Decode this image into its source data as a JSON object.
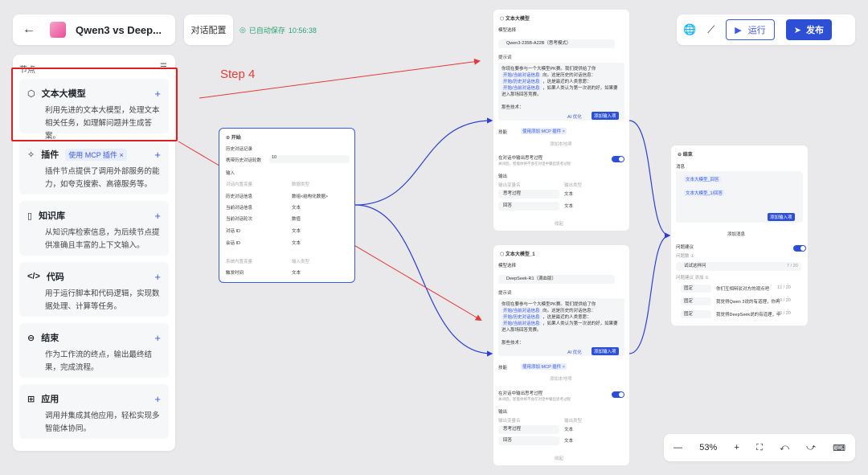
{
  "topbar": {
    "title": "Qwen3 vs Deep...",
    "config_tab": "对话配置",
    "autosave": "已自动保存",
    "autosave_time": "10:56:38",
    "run": "运行",
    "publish": "发布"
  },
  "panel": {
    "heading": "节点",
    "items": [
      {
        "name": "文本大模型",
        "desc": "利用先进的文本大模型，处理文本相关任务，如理解问题并生成答案。"
      },
      {
        "name": "插件",
        "tag": "使用 MCP 插件 ×",
        "desc": "插件节点提供了调用外部服务的能力，如夸克搜索、高德服务等。"
      },
      {
        "name": "知识库",
        "desc": "从知识库检索信息，为后续节点提供准确且丰富的上下文输入。"
      },
      {
        "name": "代码",
        "desc": "用于运行脚本和代码逻辑，实现数据处理、计算等任务。"
      },
      {
        "name": "结束",
        "desc": "作为工作流的终点，输出最终结果，完成流程。"
      },
      {
        "name": "应用",
        "desc": "调用并集成其他应用，轻松实现多智能体协同。"
      }
    ]
  },
  "annotation": "Step 4",
  "start": {
    "title": "开始",
    "history": "历史对话记录",
    "history_rounds_label": "携带历史对话轮数",
    "history_rounds": "10",
    "input": "输入",
    "col1": "对话内置变量",
    "col2": "数据类型",
    "rows": [
      [
        "历史对话信息",
        "数组<结构化数据>"
      ],
      [
        "当前对话信息",
        "文本"
      ],
      [
        "当前对话轮次",
        "数值"
      ],
      [
        "对话 ID",
        "文本"
      ],
      [
        "会话 ID",
        "文本"
      ]
    ],
    "col3": "系统内置变量",
    "col4": "输入类型",
    "trigger": "触发时间",
    "trigger_type": "文本"
  },
  "llm1": {
    "title": "文本大模型",
    "model_label": "模型选择",
    "model": "Qwen3-235B-A22B（思考模式）",
    "prompt_label": "提示词",
    "prompt": "你现在要参与一个大模型PK赛。我们提供给了你",
    "prompt_chips": [
      "开始/当前对话信息",
      "开始/历史对话信息",
      "开始/当前对话信息"
    ],
    "prompt_lines": [
      "向。这是历史的对话信息：",
      "，这是最近的人类意愿：",
      "，如果人类认为第一次说的好，如果要",
      "进入那场回答竞赛。"
    ],
    "prompt_end": "那些技术：",
    "ai_opt": "AI 优化",
    "add_input": "添加输入项",
    "skill": "技能",
    "skill_tag": "使用添加 MCP 插件 ×",
    "add_skill": "添加本地项",
    "think_label": "在对话中输出思考过程",
    "think_sub": "关闭后，智能体将不会在对话中输出思考过程",
    "output": "输出",
    "out_col1": "输出变量名",
    "out_col2": "输出类型",
    "outs": [
      [
        "思考过程",
        "文本"
      ],
      [
        "回答",
        "文本"
      ]
    ],
    "collapse": "收起"
  },
  "llm2": {
    "title": "文本大模型_1",
    "model_label": "模型选择",
    "model": "DeepSeek-R1（满血版）",
    "prompt_label": "提示词",
    "prompt": "你现在要参与一个大模型PK赛。我们提供给了你",
    "prompt_chips": [
      "开始/当前对话信息",
      "开始/历史对话信息",
      "开始/当前对话信息"
    ],
    "prompt_lines": [
      "向。这是历史的对话信息：",
      "，这是最近的人类意愿：",
      "，如果人类认为第一次说的好，如果要",
      "进入那场回答竞赛。"
    ],
    "prompt_end": "那些技术：",
    "ai_opt": "AI 优化",
    "add_input": "添加输入项",
    "skill": "技能",
    "skill_tag": "使用添加 MCP 插件 ×",
    "add_skill": "添加本地项",
    "think_label": "在对话中输出思考过程",
    "think_sub": "关闭后，智能体将不会在对话中输出思考过程",
    "output": "输出",
    "out_col1": "输出变量名",
    "out_col2": "输出类型",
    "outs": [
      [
        "思考过程",
        "文本"
      ],
      [
        "回答",
        "文本"
      ]
    ],
    "collapse": "收起"
  },
  "end": {
    "title": "结束",
    "msg_label": "消息",
    "chips": [
      "文本大模型_回答",
      "文本大模型_1/回答"
    ],
    "add_input": "添加输入项",
    "add_msg": "添加消息",
    "suggest_label": "问题建议",
    "suggest_sub": "问题数 ①",
    "preset": "试试这样问",
    "preset_count": "7 / 20",
    "rec_label": "问题建议 添加 ①",
    "rows": [
      [
        "固定",
        "你们互相辩驳对方的观点吧",
        "12 / 20"
      ],
      [
        "固定",
        "我觉得Qwen 3说的有道理，你再",
        "19 / 20"
      ],
      [
        "固定",
        "我觉得DeepSeek说的有道理，中",
        "20 / 20"
      ]
    ]
  },
  "zoom": {
    "level": "53%"
  }
}
